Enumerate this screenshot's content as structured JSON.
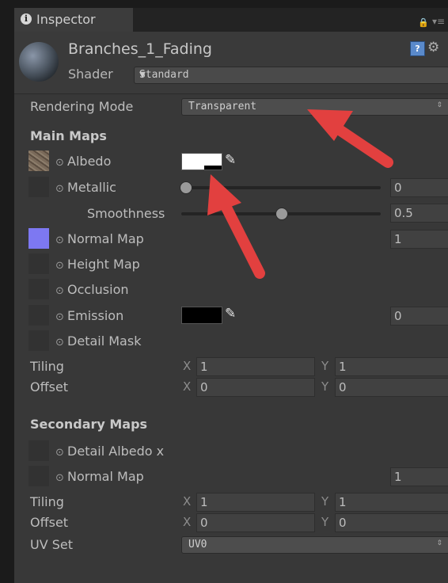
{
  "tab": {
    "label": "Inspector",
    "info_glyph": "i"
  },
  "object": {
    "name": "Branches_1_Fading"
  },
  "shader": {
    "label": "Shader",
    "value": "Standard"
  },
  "rendering_mode": {
    "label": "Rendering Mode",
    "value": "Transparent"
  },
  "main_maps": {
    "title": "Main Maps",
    "albedo": {
      "label": "Albedo",
      "color": "#ffffff"
    },
    "metallic": {
      "label": "Metallic",
      "value": "0"
    },
    "smoothness": {
      "label": "Smoothness",
      "value": "0.5"
    },
    "normal_map": {
      "label": "Normal Map",
      "value": "1"
    },
    "height_map": {
      "label": "Height Map"
    },
    "occlusion": {
      "label": "Occlusion"
    },
    "emission": {
      "label": "Emission",
      "value": "0",
      "color": "#000000"
    },
    "detail_mask": {
      "label": "Detail Mask"
    },
    "tiling": {
      "label": "Tiling",
      "x_label": "X",
      "x": "1",
      "y_label": "Y",
      "y": "1"
    },
    "offset": {
      "label": "Offset",
      "x_label": "X",
      "x": "0",
      "y_label": "Y",
      "y": "0"
    }
  },
  "secondary_maps": {
    "title": "Secondary Maps",
    "detail_albedo": {
      "label": "Detail Albedo x"
    },
    "normal_map": {
      "label": "Normal Map",
      "value": "1"
    },
    "tiling": {
      "label": "Tiling",
      "x_label": "X",
      "x": "1",
      "y_label": "Y",
      "y": "1"
    },
    "offset": {
      "label": "Offset",
      "x_label": "X",
      "x": "0",
      "y_label": "Y",
      "y": "0"
    },
    "uv_set": {
      "label": "UV Set",
      "value": "UV0"
    }
  },
  "slider_levels": {
    "metallic": 0.0,
    "smoothness": 0.5
  },
  "annotation_color": "#e2403f",
  "icons": {
    "info": "info-icon",
    "lock": "lock-icon",
    "menu": "menu-icon",
    "help": "help-book-icon",
    "settings": "gear-icon",
    "pipette": "eyedropper-icon",
    "map_selector": "circle-dot-icon"
  }
}
